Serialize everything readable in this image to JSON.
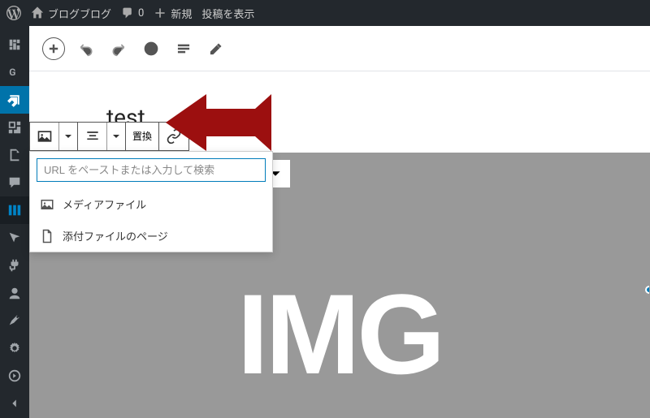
{
  "adminbar": {
    "site_name": "ブログブログ",
    "comments_count": "0",
    "new_label": "新規",
    "view_post": "投稿を表示"
  },
  "editor": {
    "title": "test",
    "replace_label": "置換",
    "img_placeholder": "IMG"
  },
  "link_dropdown": {
    "placeholder": "URL をペーストまたは入力して検索",
    "options": [
      {
        "icon": "media",
        "label": "メディアファイル"
      },
      {
        "icon": "page",
        "label": "添付ファイルのページ"
      }
    ]
  },
  "colors": {
    "arrow": "#9c0f0f",
    "accent": "#007cba",
    "adminbar": "#23282d"
  }
}
